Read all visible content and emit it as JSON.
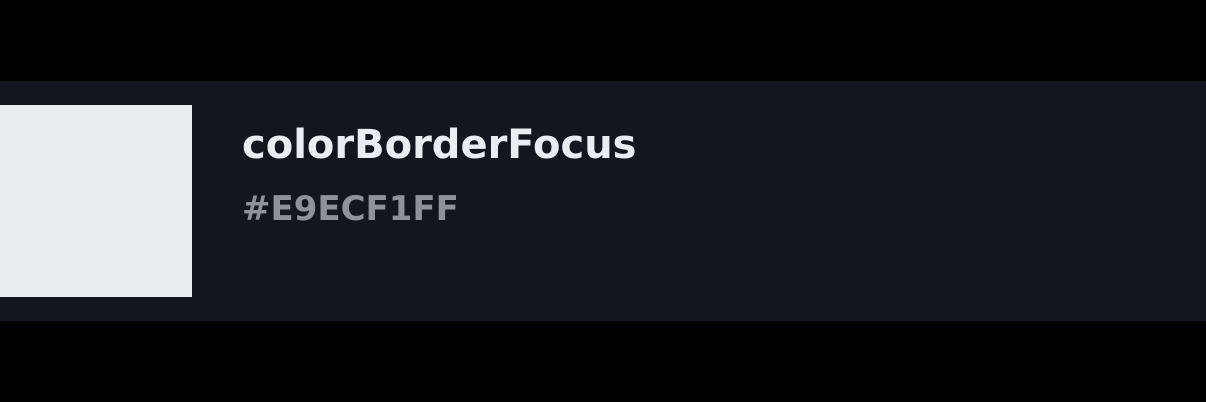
{
  "token": {
    "name": "colorBorderFocus",
    "hex": "#E9ECF1FF",
    "swatch_color": "#E9ECF1"
  },
  "colors": {
    "background": "#000000",
    "panel": "#12161E",
    "name_text": "#E9ECF1",
    "hex_text": "#8E939B"
  }
}
